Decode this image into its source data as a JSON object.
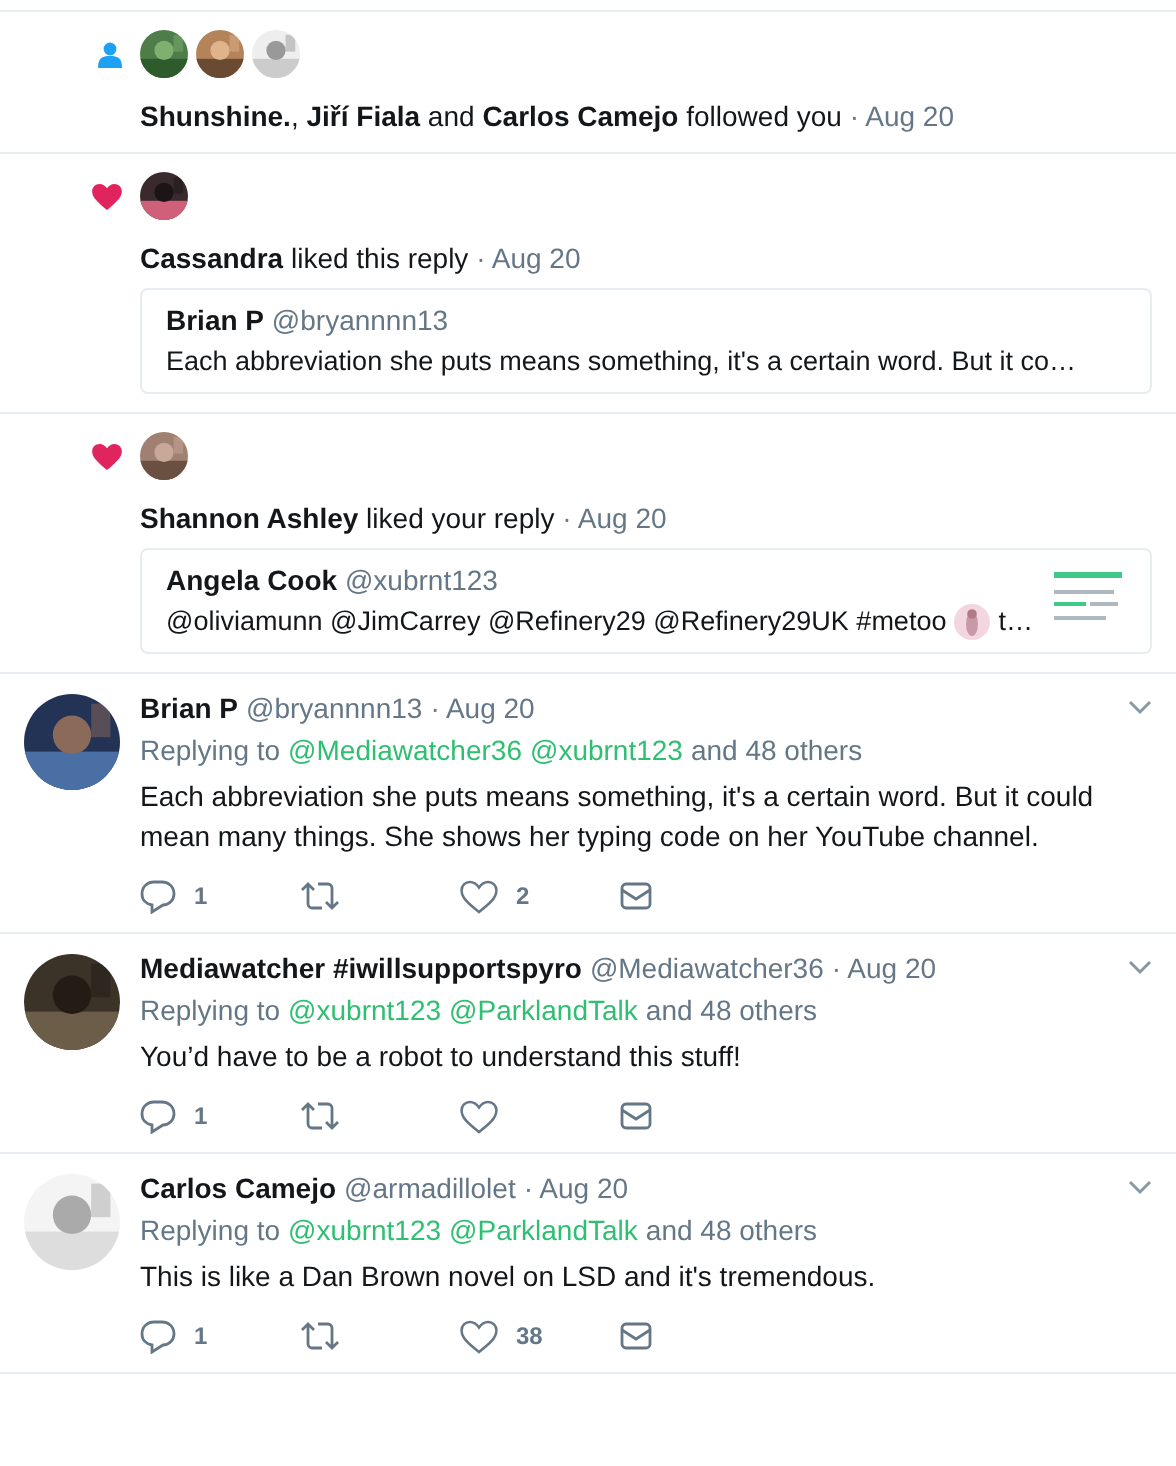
{
  "notifications": [
    {
      "kind": "follow",
      "text": "**Shunshine.**, **Jiří Fiala** and **Carlos Camejo** followed you",
      "time": "· Aug 20"
    },
    {
      "kind": "like",
      "text": "**Cassandra** liked this reply",
      "time": "· Aug 20",
      "quote": {
        "name": "Brian P",
        "handle": "@bryannnn13",
        "text": "Each abbreviation she puts means something, it's a certain word. But it co…"
      }
    },
    {
      "kind": "like",
      "text": "**Shannon Ashley** liked your reply",
      "time": "· Aug 20",
      "quote": {
        "name": "Angela Cook",
        "handle": "@xubrnt123",
        "text": "@oliviamunn @JimCarrey @Refinery29 @Refinery29UK #metoo",
        "text_after": "t…"
      }
    }
  ],
  "tweets": [
    {
      "name": "Brian P",
      "handle": "@bryannnn13",
      "time": "· Aug 20",
      "replying": "Replying to",
      "mentions": [
        "@Mediawatcher36",
        "@xubrnt123"
      ],
      "others": "and 48 others",
      "text": "Each abbreviation she puts means something, it's a certain word. But it could mean many things. She shows her typing code on her YouTube channel.",
      "reply_count": "1",
      "like_count": "2"
    },
    {
      "name": "Mediawatcher #iwillsupportspyro",
      "handle": "@Mediawatcher36",
      "time": "· Aug 20",
      "replying": "Replying to",
      "mentions": [
        "@xubrnt123",
        "@ParklandTalk"
      ],
      "others": "and 48 others",
      "text": "You’d have to be a robot to understand this stuff!",
      "reply_count": "1"
    },
    {
      "name": "Carlos Camejo",
      "handle": "@armadillolet",
      "time": "· Aug 20",
      "replying": "Replying to",
      "mentions": [
        "@xubrnt123",
        "@ParklandTalk"
      ],
      "others": "and 48 others",
      "text": "This is like a Dan Brown novel on LSD and it's tremendous.",
      "reply_count": "1",
      "like_count": "38"
    }
  ]
}
